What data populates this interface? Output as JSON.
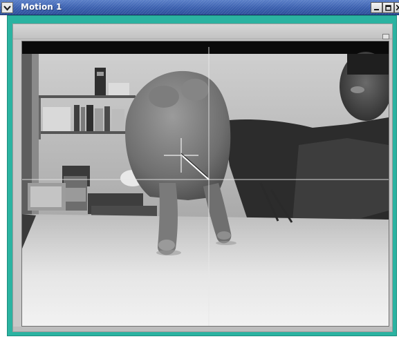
{
  "window": {
    "title": "Motion 1",
    "menu_icon": "chevron-down-icon",
    "buttons": {
      "minimize_icon": "minimize-icon",
      "maximize_icon": "maximize-icon",
      "close_icon": "close-icon"
    }
  },
  "colors": {
    "titlebar": "#3a5fae",
    "frame": "#2bb3a1",
    "panel": "#c8c8c8"
  },
  "viewport": {
    "content": "camera-feed",
    "overlay": "crosshair-tracking-lines"
  }
}
